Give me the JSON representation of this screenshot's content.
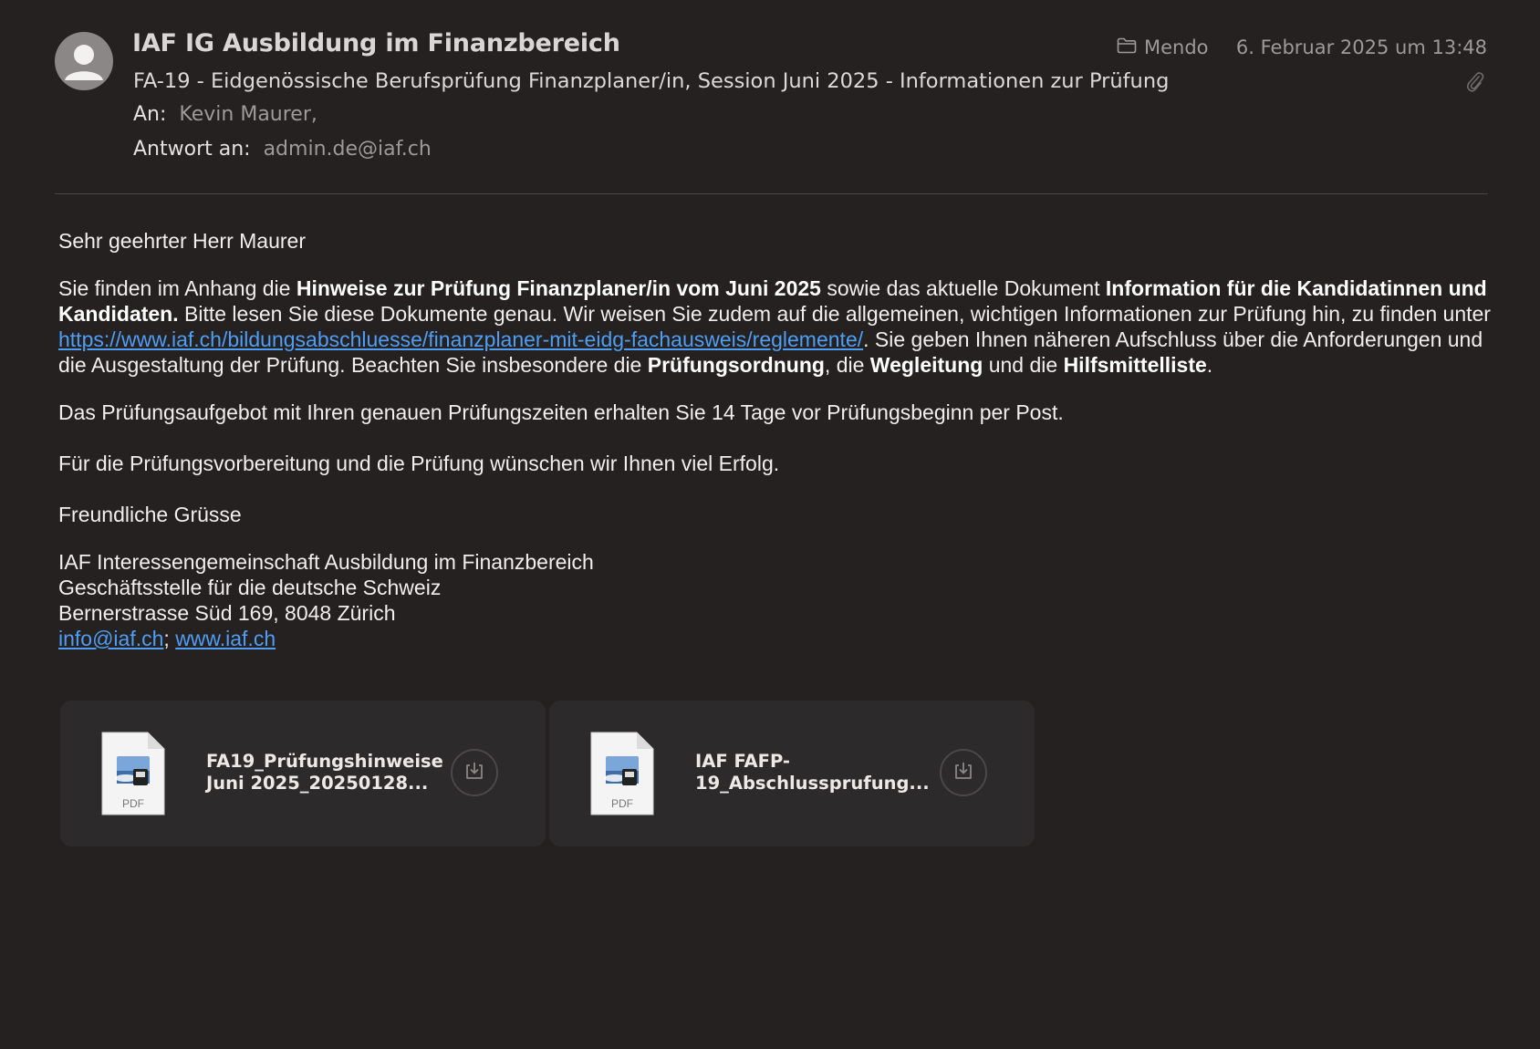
{
  "header": {
    "sender": "IAF IG Ausbildung im Finanzbereich",
    "subject": "FA-19 - Eidgenössische Berufsprüfung Finanzplaner/in, Session Juni 2025 - Informationen zur Prüfung",
    "folder": "Mendo",
    "date": "6. Februar 2025 um 13:48",
    "to_label": "An:",
    "to_value": "Kevin Maurer,",
    "reply_label": "Antwort an:",
    "reply_value": "admin.de@iaf.ch"
  },
  "body": {
    "greeting": "Sehr geehrter Herr Maurer",
    "p1_a": "Sie finden im Anhang die ",
    "p1_b": "Hinweise zur Prüfung Finanzplaner/in vom Juni 2025",
    "p1_c": " sowie das aktuelle Dokument ",
    "p1_d": "Information für die Kandidatinnen und Kandidaten.",
    "p1_e": "  Bitte lesen Sie diese Dokumente genau. Wir weisen Sie zudem auf die allgemeinen, wichtigen Informationen zur Prüfung hin, zu finden unter ",
    "p1_link": "https://www.iaf.ch/bildungsabschluesse/finanzplaner-mit-eidg-fachausweis/reglemente/",
    "p1_f": ". Sie geben Ihnen näheren Aufschluss über die Anforderungen und die Ausgestaltung der Prüfung. Beachten Sie insbesondere die ",
    "p1_g": "Prüfungsordnung",
    "p1_h": ", die ",
    "p1_i": "Wegleitung",
    "p1_j": " und die ",
    "p1_k": "Hilfsmittelliste",
    "p1_l": ".",
    "p2": "Das Prüfungsaufgebot mit Ihren genauen Prüfungszeiten erhalten Sie 14 Tage vor Prüfungsbeginn per Post.",
    "p3": "Für die Prüfungsvorbereitung und die Prüfung wünschen wir Ihnen viel Erfolg.",
    "closing": "Freundliche Grüsse",
    "sig_line1": "IAF Interessengemeinschaft Ausbildung im Finanzbereich",
    "sig_line2": "Geschäftsstelle für die deutsche Schweiz",
    "sig_line3": "Bernerstrasse Süd 169, 8048 Zürich",
    "sig_email": "info@iaf.ch",
    "sig_sep": "; ",
    "sig_web": "www.iaf.ch"
  },
  "attachments": [
    {
      "name_line1": "FA19_Prüfungshinweise",
      "name_line2": "Juni 2025_20250128...",
      "type_label": "PDF",
      "icon": "pdf-file-icon"
    },
    {
      "name_line1": "IAF FAFP-",
      "name_line2": "19_Abschlussprufung...",
      "type_label": "PDF",
      "icon": "pdf-file-icon"
    }
  ],
  "colors": {
    "background": "#242120",
    "link": "#4f9ef5",
    "secondary_text": "#9e9a97",
    "attachment_card": "#2c2a2b"
  }
}
